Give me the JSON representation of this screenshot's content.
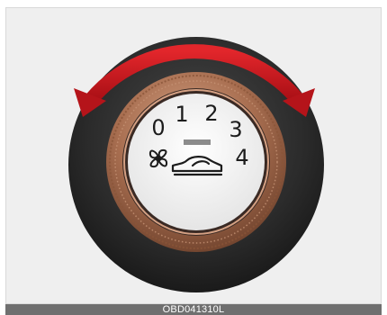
{
  "control": {
    "speed_labels": [
      "0",
      "1",
      "2",
      "3",
      "4"
    ]
  },
  "caption": {
    "code": "OBD041310L"
  },
  "colors": {
    "rotation_arrow": "#c8141c",
    "bezel_copper": "#b07a5c",
    "housing": "#2a2a2a",
    "dial_face": "#f4f4f4"
  },
  "icons": [
    "fan-icon",
    "car-defrost-icon",
    "indicator-mark",
    "rotation-arrow-icon"
  ]
}
